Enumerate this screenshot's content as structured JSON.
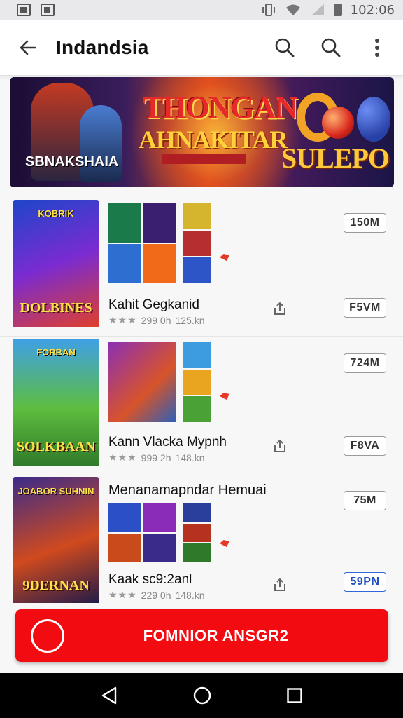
{
  "status_bar": {
    "time": "102:06"
  },
  "app_bar": {
    "title": "Indandsia",
    "back_icon": "arrow-left-icon",
    "search_icon": "search-icon",
    "overflow_icon": "more-vert-icon"
  },
  "banner": {
    "left_text": "SBNAKSHAIA",
    "title_line1": "THONGAN",
    "title_line2": "AHNAKITAR",
    "right_title": "SULEPO"
  },
  "apps": [
    {
      "cover_title": "DOLBINES",
      "cover_top": "KOBRIK",
      "name": "Kahit Gegkanid",
      "rating_text": "299 0h",
      "size": "125.kn",
      "buttons": [
        "150M",
        "F5VM"
      ],
      "cover_colors": [
        "#1d46c9",
        "#7a2bd1",
        "#e0402a"
      ],
      "thumbs_big": [
        "#1a7a4a",
        "#3a1f70",
        "#2c6fd0",
        "#f06a1a"
      ],
      "thumbs_small": [
        "#d6b52e",
        "#b62e2e",
        "#2d55c8"
      ]
    },
    {
      "cover_title": "SOLKBAAN",
      "cover_top": "FORBAN",
      "name": "Kann Vlacka Mypnh",
      "rating_text": "999 2h",
      "size": "148.kn",
      "buttons": [
        "724M",
        "F8VA"
      ],
      "cover_colors": [
        "#3fa0e6",
        "#5ebd3f",
        "#2f7a2a"
      ],
      "thumbs_big": [
        "#8b2fb5"
      ],
      "thumbs_small": [
        "#3d9be0",
        "#e9a520",
        "#4aa136"
      ]
    },
    {
      "cover_title": "9DERNAN",
      "cover_top": "JOABOR SUHNIN",
      "name": "Kaak sc9:2anl",
      "rating_text": "229 0h",
      "size": "148.kn",
      "header": "Menanamapndar Hemuai",
      "buttons": [
        "75M",
        "59PN"
      ],
      "cover_colors": [
        "#3b2b8a",
        "#d04a1e",
        "#1e1a4a"
      ],
      "thumbs_big": [
        "#2a4fc7",
        "#8a2cb8",
        "#c94a1a",
        "#3a2a8a"
      ],
      "thumbs_small": [
        "#2a3f9c",
        "#b5321e",
        "#2f7a2a"
      ]
    }
  ],
  "cta": {
    "label": "FOMNIOR ANSGR2"
  },
  "nav": {
    "back_icon": "nav-back-icon",
    "home_icon": "nav-home-icon",
    "recents_icon": "nav-recents-icon"
  }
}
